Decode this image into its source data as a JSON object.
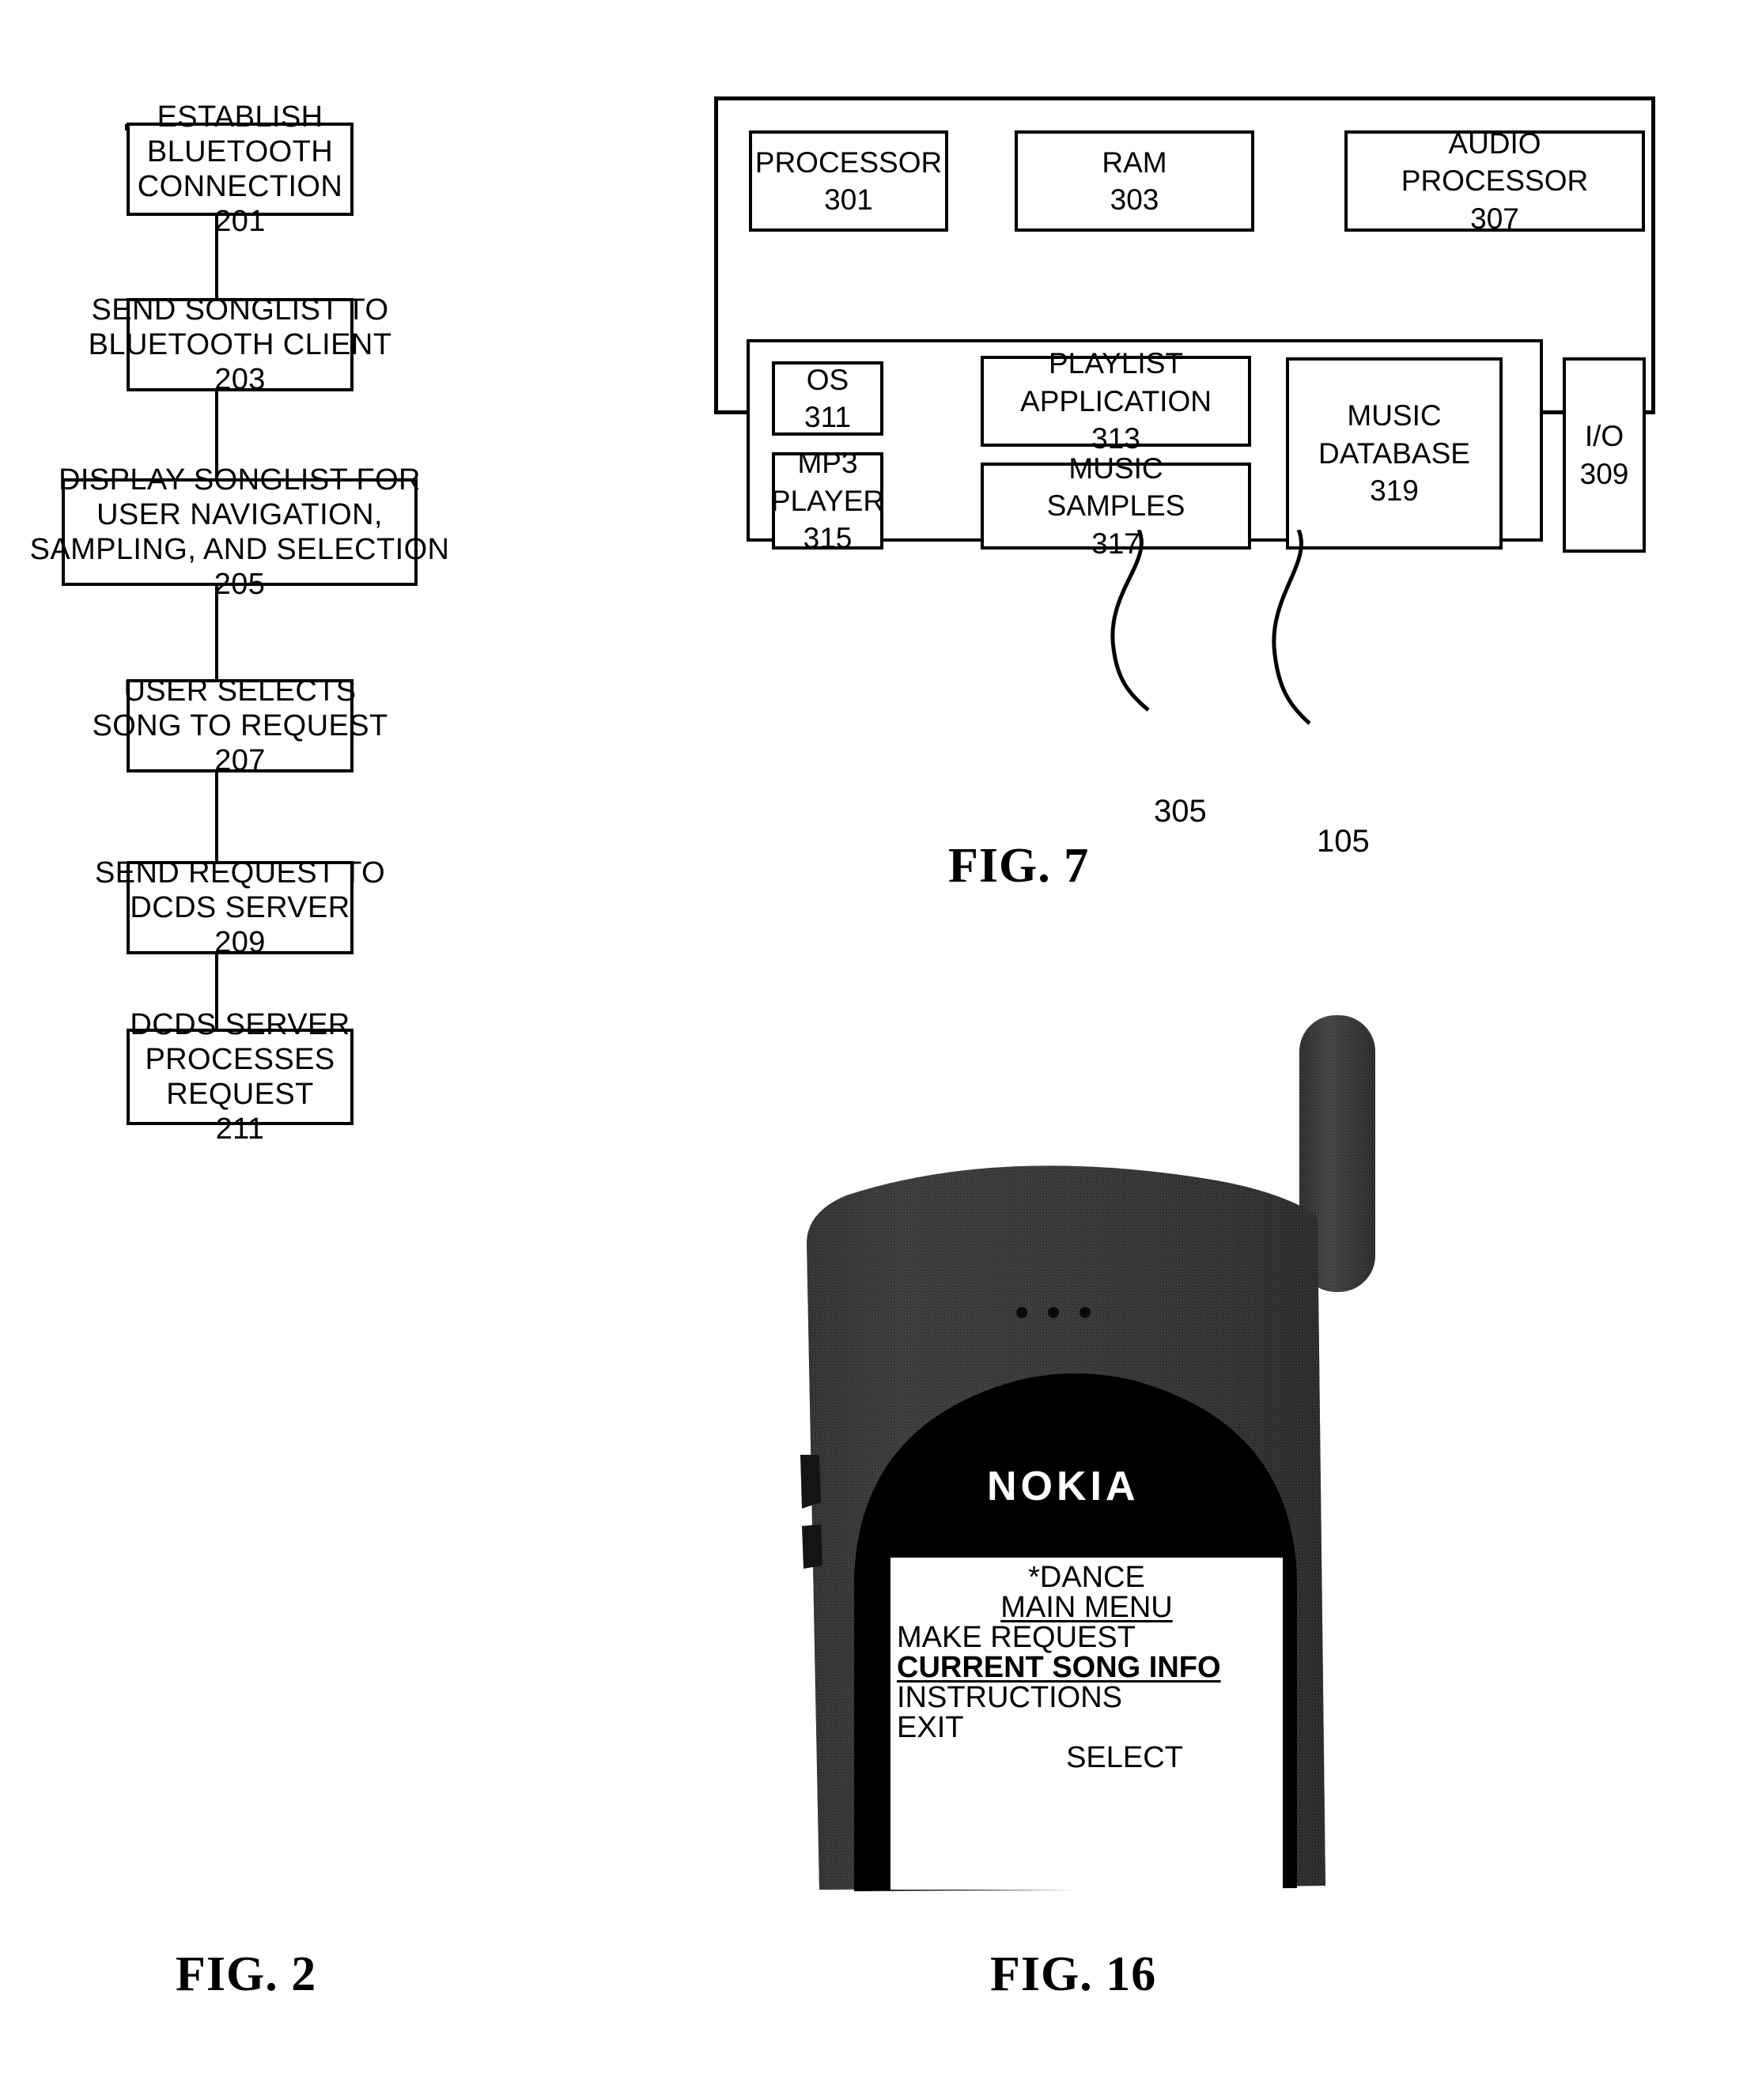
{
  "figure_2": {
    "label": "FIG. 2",
    "type": "flowchart",
    "steps": [
      {
        "id": "201",
        "lines": [
          "ESTABLISH",
          "BLUETOOTH",
          "CONNECTION"
        ],
        "number": "201"
      },
      {
        "id": "203",
        "lines": [
          "SEND SONGLIST TO",
          "BLUETOOTH CLIENT"
        ],
        "number": "203"
      },
      {
        "id": "205",
        "lines": [
          "DISPLAY SONGLIST FOR",
          "USER NAVIGATION,",
          "SAMPLING, AND SELECTION"
        ],
        "number": "205"
      },
      {
        "id": "207",
        "lines": [
          "USER SELECTS",
          "SONG TO REQUEST"
        ],
        "number": "207"
      },
      {
        "id": "209",
        "lines": [
          "SEND REQUEST TO",
          "DCDS SERVER"
        ],
        "number": "209"
      },
      {
        "id": "211",
        "lines": [
          "DCDS SERVER",
          "PROCESSES",
          "REQUEST"
        ],
        "number": "211"
      }
    ]
  },
  "figure_7": {
    "label": "FIG. 7",
    "type": "block-diagram",
    "blocks": [
      {
        "id": "processor",
        "lines": [
          "PROCESSOR"
        ],
        "number": "301"
      },
      {
        "id": "ram",
        "lines": [
          "RAM"
        ],
        "number": "303"
      },
      {
        "id": "audio_processor",
        "lines": [
          "AUDIO",
          "PROCESSOR"
        ],
        "number": "307"
      },
      {
        "id": "os",
        "lines": [
          "OS"
        ],
        "number": "311"
      },
      {
        "id": "playlist_application",
        "lines": [
          "PLAYLIST",
          "APPLICATION"
        ],
        "number": "313"
      },
      {
        "id": "mp3_player",
        "lines": [
          "MP3",
          "PLAYER"
        ],
        "number": "315"
      },
      {
        "id": "music_samples",
        "lines": [
          "MUSIC",
          "SAMPLES"
        ],
        "number": "317"
      },
      {
        "id": "music_database",
        "lines": [
          "MUSIC",
          "DATABASE"
        ],
        "number": "319"
      },
      {
        "id": "io",
        "lines": [
          "I/O"
        ],
        "number": "309"
      }
    ],
    "leader_labels": [
      {
        "id": "memory",
        "number": "305"
      },
      {
        "id": "device",
        "number": "105"
      }
    ]
  },
  "figure_16": {
    "label": "FIG. 16",
    "type": "device-photo",
    "device": {
      "brand": "NOKIA"
    },
    "screen": {
      "status_line": "*DANCE",
      "title": "MAIN MENU",
      "menu_items": [
        {
          "label": "MAKE REQUEST",
          "selected": false
        },
        {
          "label": "CURRENT SONG INFO",
          "selected": true
        },
        {
          "label": "INSTRUCTIONS",
          "selected": false
        },
        {
          "label": "EXIT",
          "selected": false
        }
      ],
      "softkey": "SELECT"
    }
  }
}
